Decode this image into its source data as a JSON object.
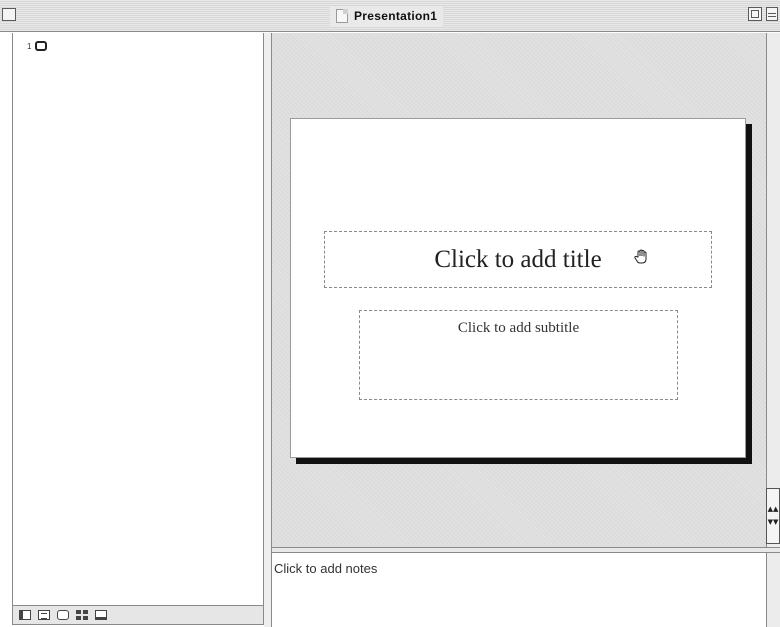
{
  "window": {
    "title": "Presentation1",
    "close_icon": "close-box-icon",
    "zoom_icon": "zoom-box-icon",
    "collapse_icon": "collapse-box-icon"
  },
  "outline": {
    "slide_number": "1",
    "slide_icon": "slide-icon"
  },
  "view_buttons": [
    {
      "name": "normal-view",
      "icon": "normal-view-icon"
    },
    {
      "name": "outline-view",
      "icon": "outline-view-icon"
    },
    {
      "name": "slide-view",
      "icon": "slide-view-icon"
    },
    {
      "name": "slide-sorter-view",
      "icon": "slide-sorter-icon"
    },
    {
      "name": "slide-show",
      "icon": "slide-show-icon"
    }
  ],
  "slide": {
    "title_placeholder": "Click to add title",
    "subtitle_placeholder": "Click to add subtitle",
    "cursor_icon": "hand-cursor-icon"
  },
  "navigation": {
    "previous_icon": "previous-slide-icon",
    "next_icon": "next-slide-icon"
  },
  "notes": {
    "placeholder": "Click to add notes"
  }
}
